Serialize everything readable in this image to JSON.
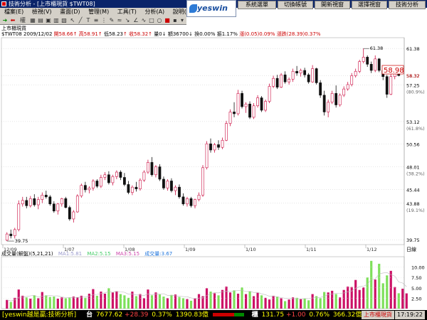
{
  "window": {
    "title": "技術分析 - [上市櫃現貨 $TWT08]"
  },
  "menu": [
    "檔案(E)",
    "檢視(V)",
    "畫面(D)",
    "管理(M)",
    "工具(T)",
    "分析(A)",
    "說明(H)"
  ],
  "brand_logo": "yeswin",
  "top_buttons": [
    "系統選單",
    "切換帳號",
    "開新視窗",
    "選擇視窗",
    "技術分析"
  ],
  "chart_header": {
    "name": "上市櫃現貨",
    "symbol_date": "$TWT08 2009/12/02",
    "open": "開58.66",
    "high": "高58.91",
    "low": "低58.23",
    "close": "收58.32",
    "qty": "量0",
    "amount": "額36700",
    "turnover": "換0.00%",
    "amplitude": "振1.17%",
    "change": "漲(0.05)0.09%",
    "cum_change": "漲跌(28.39)0.37%"
  },
  "volume_header": {
    "title": "成交量(解盤)(5,21,21)",
    "ma1": "MA1:5.81",
    "ma2": "MA2:5.15",
    "ma3": "MA3:5.15",
    "current": "成交量:3.67"
  },
  "status_bar": {
    "brand": "[yeswin越是贏:技術分析]",
    "tx_label": "台",
    "tx_value": "7677.62",
    "tx_change": "+28.39",
    "tx_pct": "0.37%",
    "tx_amount": "1390.83億",
    "otc_label": "櫃",
    "otc_value": "131.75",
    "otc_change": "+1.00",
    "otc_pct": "0.76%",
    "otc_amount": "366.32億",
    "stocks_button": "上市櫃現貨",
    "time": "17:19:22"
  },
  "colors": {
    "up": "#cc1144",
    "down": "#111111",
    "vol_up": "#cc1166",
    "vol_down": "#7ee05a",
    "titlebar": "#0a246a"
  },
  "chart_data": {
    "type": "candlestick",
    "price_axis": {
      "ylim": [
        39.2,
        62.6
      ],
      "ticks": [
        "61.38",
        "58.32",
        "57.25",
        "(80.9%)",
        "53.12",
        "(61.8%)",
        "50.56",
        "48.01",
        "(38.2%)",
        "45.44",
        "43.88",
        "(19.1%)",
        "39.75"
      ]
    },
    "x_labels": [
      "12/09",
      "1/07",
      "1/08",
      "1/09",
      "1/10",
      "1/11",
      "1/12"
    ],
    "x_unit": "日線",
    "annotations": {
      "high": "61.38",
      "low": "39.75",
      "last_price": "58.98",
      "current": "58.32"
    },
    "candles": [
      [
        39.7,
        40.6,
        39.6,
        40.4
      ],
      [
        40.4,
        40.9,
        39.9,
        40.2
      ],
      [
        40.2,
        41.1,
        39.9,
        40.9
      ],
      [
        40.9,
        44.2,
        40.7,
        43.8
      ],
      [
        43.8,
        44.6,
        43.5,
        44.2
      ],
      [
        44.2,
        44.6,
        43.3,
        43.6
      ],
      [
        43.6,
        44.7,
        43.4,
        44.4
      ],
      [
        44.4,
        44.9,
        43.5,
        43.7
      ],
      [
        43.7,
        44.6,
        43.2,
        44.3
      ],
      [
        44.3,
        45.1,
        43.9,
        44.8
      ],
      [
        44.8,
        45.3,
        44.4,
        44.6
      ],
      [
        44.6,
        44.8,
        43.6,
        43.8
      ],
      [
        43.8,
        44.1,
        42.8,
        43.0
      ],
      [
        43.0,
        43.9,
        42.6,
        43.8
      ],
      [
        43.8,
        44.5,
        43.5,
        44.4
      ],
      [
        44.4,
        44.6,
        43.3,
        43.4
      ],
      [
        43.4,
        43.6,
        41.9,
        42.1
      ],
      [
        42.1,
        43.1,
        41.7,
        42.9
      ],
      [
        42.9,
        44.9,
        42.8,
        44.7
      ],
      [
        44.7,
        46.1,
        44.5,
        45.9
      ],
      [
        45.9,
        46.3,
        45.1,
        45.4
      ],
      [
        45.4,
        45.8,
        45.0,
        45.6
      ],
      [
        45.6,
        46.6,
        45.3,
        46.4
      ],
      [
        46.4,
        46.6,
        45.6,
        45.8
      ],
      [
        45.8,
        47.1,
        45.6,
        46.8
      ],
      [
        46.8,
        47.4,
        46.5,
        47.1
      ],
      [
        47.1,
        47.5,
        46.0,
        46.2
      ],
      [
        46.2,
        47.1,
        45.9,
        46.9
      ],
      [
        46.9,
        47.6,
        46.6,
        47.4
      ],
      [
        47.4,
        47.6,
        46.5,
        46.8
      ],
      [
        46.8,
        47.3,
        45.8,
        46.0
      ],
      [
        46.0,
        46.4,
        44.9,
        45.1
      ],
      [
        45.1,
        45.9,
        44.8,
        45.7
      ],
      [
        45.7,
        46.3,
        45.2,
        45.5
      ],
      [
        45.5,
        46.7,
        45.3,
        46.5
      ],
      [
        46.5,
        47.6,
        46.3,
        47.4
      ],
      [
        47.4,
        48.8,
        47.2,
        48.5
      ],
      [
        48.5,
        49.1,
        46.9,
        47.1
      ],
      [
        47.1,
        48.2,
        46.8,
        48.0
      ],
      [
        48.0,
        48.3,
        46.4,
        46.6
      ],
      [
        46.6,
        46.9,
        45.4,
        45.6
      ],
      [
        45.6,
        46.6,
        45.3,
        46.4
      ],
      [
        46.4,
        46.7,
        45.1,
        45.3
      ],
      [
        45.3,
        45.9,
        44.8,
        45.7
      ],
      [
        45.7,
        46.0,
        44.4,
        44.6
      ],
      [
        44.6,
        45.0,
        43.6,
        43.8
      ],
      [
        43.8,
        44.6,
        43.5,
        44.4
      ],
      [
        44.4,
        44.6,
        43.4,
        43.6
      ],
      [
        43.6,
        44.4,
        43.3,
        44.3
      ],
      [
        44.3,
        45.1,
        44.1,
        44.8
      ],
      [
        44.8,
        48.2,
        44.6,
        47.9
      ],
      [
        47.9,
        50.9,
        47.7,
        50.6
      ],
      [
        50.6,
        51.2,
        49.6,
        49.9
      ],
      [
        49.9,
        50.7,
        49.6,
        50.5
      ],
      [
        50.5,
        51.0,
        49.9,
        50.2
      ],
      [
        50.2,
        51.3,
        50.0,
        51.0
      ],
      [
        51.0,
        53.2,
        50.9,
        52.9
      ],
      [
        52.9,
        54.5,
        52.6,
        54.2
      ],
      [
        54.2,
        55.3,
        53.6,
        54.0
      ],
      [
        54.0,
        56.7,
        53.8,
        56.3
      ],
      [
        56.3,
        56.6,
        54.6,
        54.8
      ],
      [
        54.8,
        55.3,
        54.1,
        55.1
      ],
      [
        55.1,
        55.4,
        53.4,
        53.6
      ],
      [
        53.6,
        55.2,
        53.4,
        54.9
      ],
      [
        54.9,
        56.1,
        54.7,
        55.8
      ],
      [
        55.8,
        56.0,
        54.2,
        54.4
      ],
      [
        54.4,
        55.6,
        54.2,
        55.4
      ],
      [
        55.4,
        57.4,
        55.2,
        57.1
      ],
      [
        57.1,
        58.3,
        56.9,
        58.0
      ],
      [
        58.0,
        58.4,
        56.8,
        57.0
      ],
      [
        57.0,
        58.6,
        56.9,
        58.4
      ],
      [
        58.4,
        58.8,
        57.4,
        57.6
      ],
      [
        57.6,
        58.1,
        57.3,
        57.9
      ],
      [
        57.9,
        59.1,
        57.6,
        58.8
      ],
      [
        58.8,
        59.4,
        58.3,
        58.6
      ],
      [
        58.6,
        59.1,
        58.2,
        58.9
      ],
      [
        58.9,
        59.2,
        58.1,
        58.4
      ],
      [
        58.4,
        58.6,
        57.4,
        57.6
      ],
      [
        57.6,
        59.5,
        57.5,
        59.1
      ],
      [
        59.1,
        59.2,
        57.3,
        57.5
      ],
      [
        57.5,
        57.8,
        55.8,
        56.1
      ],
      [
        56.1,
        56.6,
        53.8,
        54.2
      ],
      [
        54.2,
        55.6,
        53.6,
        55.3
      ],
      [
        55.3,
        56.6,
        55.1,
        56.3
      ],
      [
        56.3,
        57.2,
        54.7,
        55.0
      ],
      [
        55.0,
        56.3,
        54.8,
        56.1
      ],
      [
        56.1,
        57.1,
        55.9,
        56.8
      ],
      [
        56.8,
        57.6,
        56.6,
        57.3
      ],
      [
        57.3,
        58.6,
        57.1,
        58.3
      ],
      [
        58.3,
        59.1,
        58.1,
        58.8
      ],
      [
        58.8,
        60.1,
        58.6,
        59.9
      ],
      [
        59.9,
        61.38,
        59.7,
        60.4
      ],
      [
        60.4,
        60.6,
        59.3,
        59.6
      ],
      [
        59.6,
        59.9,
        58.6,
        58.9
      ],
      [
        58.9,
        60.6,
        58.7,
        60.2
      ],
      [
        60.2,
        60.3,
        58.7,
        58.9
      ],
      [
        58.9,
        59.3,
        57.8,
        58.2
      ],
      [
        58.2,
        58.4,
        55.8,
        56.2
      ],
      [
        56.2,
        58.5,
        56.1,
        58.2
      ],
      [
        58.2,
        58.9,
        57.9,
        58.7
      ],
      [
        58.66,
        58.91,
        58.23,
        58.32
      ]
    ],
    "volume": {
      "ylim": [
        0,
        12.5
      ],
      "ticks": [
        "10.00",
        "7.50",
        "5.00",
        "2.50"
      ],
      "values": [
        2.1,
        1.6,
        2.6,
        4.6,
        3.1,
        2.7,
        2.4,
        3.2,
        2.5,
        4.0,
        3.2,
        2.8,
        2.9,
        2.4,
        2.7,
        2.5,
        2.7,
        2.9,
        2.7,
        3.1,
        2.6,
        3.6,
        4.7,
        3.1,
        4.1,
        3.6,
        4.9,
        3.9,
        4.2,
        3.5,
        3.2,
        2.6,
        4.1,
        3.0,
        3.5,
        2.5,
        4.6,
        3.2,
        3.9,
        3.4,
        2.9,
        2.5,
        3.3,
        3.4,
        2.8,
        2.5,
        2.3,
        1.9,
        2.5,
        3.5,
        3.0,
        4.9,
        4.1,
        3.7,
        3.2,
        4.5,
        5.3,
        3.9,
        4.4,
        3.6,
        5.1,
        3.5,
        4.2,
        3.0,
        3.8,
        3.2,
        2.6,
        2.2,
        3.1,
        2.9,
        2.5,
        1.8,
        2.2,
        2.7,
        2.6,
        2.3,
        2.4,
        2.0,
        3.5,
        3.0,
        2.5,
        4.0,
        3.9,
        4.3,
        3.5,
        2.7,
        4.5,
        5.3,
        5.2,
        6.9,
        4.5,
        5.1,
        7.5,
        11.5,
        7.0,
        10.8,
        6.1,
        8.0,
        9.1,
        5.2,
        3.7,
        4.8,
        3.67
      ]
    }
  }
}
